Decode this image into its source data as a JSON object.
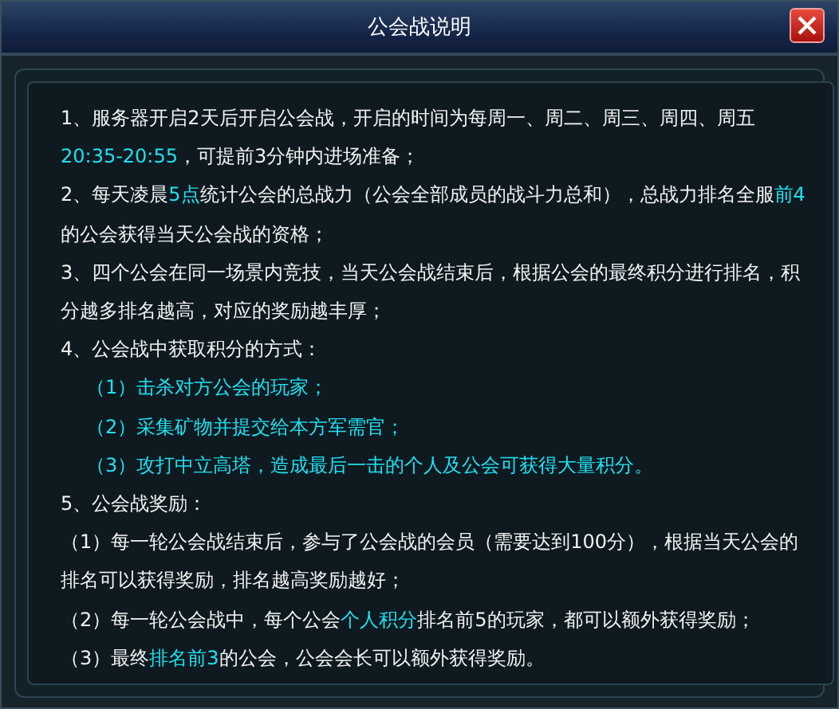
{
  "window": {
    "title": "公会战说明"
  },
  "paragraphs": [
    {
      "kind": "item",
      "segments": [
        {
          "text": "1、服务器开启2天后开启公会战，开启的时间为每周一、周二、周三、周四、周五 ",
          "highlight": false
        },
        {
          "text": "20:35-20:55",
          "highlight": true
        },
        {
          "text": "，可提前3分钟内进场准备；",
          "highlight": false
        }
      ]
    },
    {
      "kind": "item",
      "segments": [
        {
          "text": "2、每天凌晨",
          "highlight": false
        },
        {
          "text": "5点",
          "highlight": true
        },
        {
          "text": "统计公会的总战力（公会全部成员的战斗力总和），总战力排名全服",
          "highlight": false
        },
        {
          "text": "前4",
          "highlight": true
        },
        {
          "text": "的公会获得当天公会战的资格；",
          "highlight": false
        }
      ]
    },
    {
      "kind": "item",
      "segments": [
        {
          "text": "3、四个公会在同一场景内竞技，当天公会战结束后，根据公会的最终积分进行排名，积分越多排名越高，对应的奖励越丰厚；",
          "highlight": false
        }
      ]
    },
    {
      "kind": "item",
      "segments": [
        {
          "text": "4、公会战中获取积分的方式：",
          "highlight": false
        }
      ]
    },
    {
      "kind": "subitem",
      "segments": [
        {
          "text": "（1）击杀对方公会的玩家；",
          "highlight": true
        }
      ]
    },
    {
      "kind": "subitem",
      "segments": [
        {
          "text": "（2）采集矿物并提交给本方军需官；",
          "highlight": true
        }
      ]
    },
    {
      "kind": "subitem",
      "segments": [
        {
          "text": "（3）攻打中立高塔，造成最后一击的个人及公会可获得大量积分。",
          "highlight": true
        }
      ]
    },
    {
      "kind": "item",
      "segments": [
        {
          "text": "5、公会战奖励：",
          "highlight": false
        }
      ]
    },
    {
      "kind": "item",
      "segments": [
        {
          "text": "（1）每一轮公会战结束后，参与了公会战的会员（需要达到100分），根据当天公会的排名可以获得奖励，排名越高奖励越好；",
          "highlight": false
        }
      ]
    },
    {
      "kind": "item",
      "segments": [
        {
          "text": "（2）每一轮公会战中，每个公会",
          "highlight": false
        },
        {
          "text": "个人积分",
          "highlight": true
        },
        {
          "text": "排名前5的玩家，都可以额外获得奖励；",
          "highlight": false
        }
      ]
    },
    {
      "kind": "item",
      "segments": [
        {
          "text": "（3）最终",
          "highlight": false
        },
        {
          "text": "排名前3",
          "highlight": true
        },
        {
          "text": "的公会，公会会长可以额外获得奖励。",
          "highlight": false
        }
      ]
    }
  ]
}
